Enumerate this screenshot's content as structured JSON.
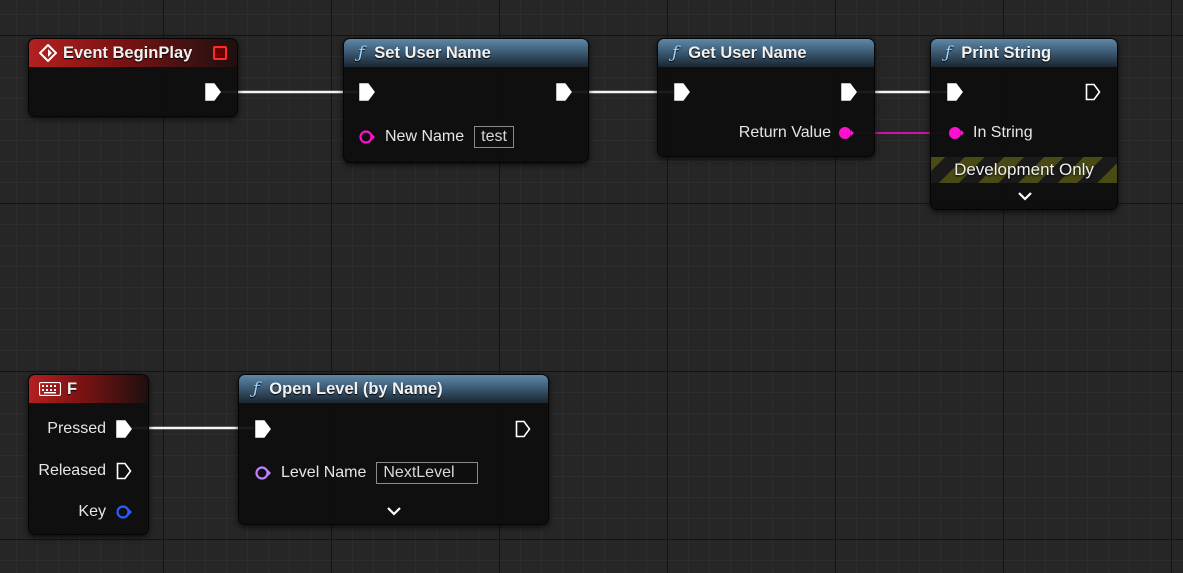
{
  "colors": {
    "exec": "#ffffff",
    "string_pin": "#ff10d0",
    "name_pin": "#c080ff",
    "key_pin": "#2050ff",
    "function_header": "#4a7090",
    "event_header": "#a01818"
  },
  "nodes": {
    "begin_play": {
      "title": "Event BeginPlay",
      "icon": "event-diamond-icon"
    },
    "set_user_name": {
      "title": "Set User Name",
      "input_label": "New Name",
      "input_value": "test",
      "icon": "function-icon"
    },
    "get_user_name": {
      "title": "Get User Name",
      "output_label": "Return Value",
      "icon": "function-icon"
    },
    "print_string": {
      "title": "Print String",
      "input_label": "In String",
      "dev_only": "Development Only",
      "icon": "function-icon"
    },
    "key_f": {
      "title": "F",
      "pressed": "Pressed",
      "released": "Released",
      "key": "Key",
      "icon": "keyboard-icon"
    },
    "open_level": {
      "title": "Open Level (by Name)",
      "input_label": "Level Name",
      "input_value": "NextLevel",
      "icon": "function-icon"
    }
  }
}
